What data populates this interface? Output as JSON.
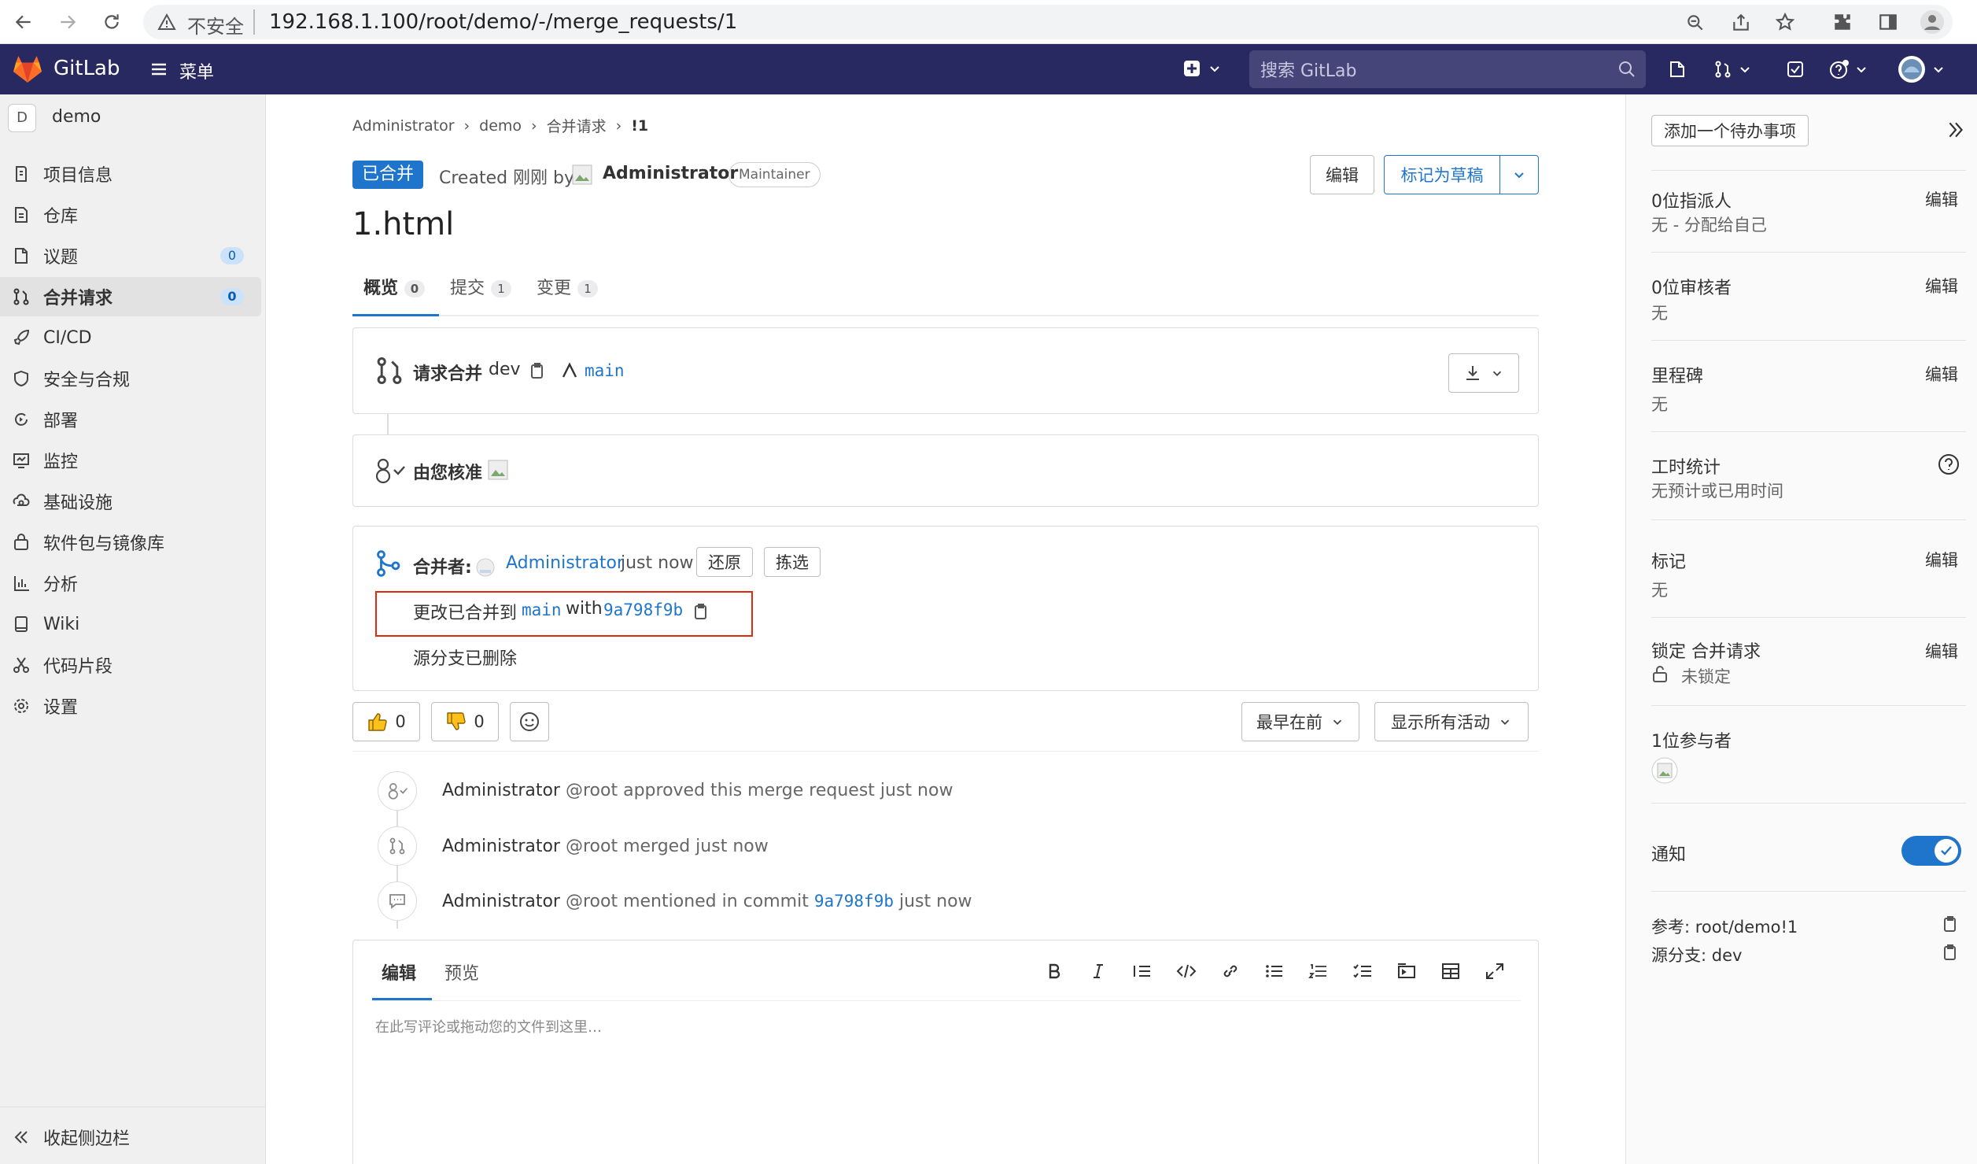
{
  "browser": {
    "security": "不安全",
    "url": "192.168.1.100/root/demo/-/merge_requests/1"
  },
  "header": {
    "brand": "GitLab",
    "menu_label": "菜单",
    "search_placeholder": "搜索 GitLab"
  },
  "sidebar": {
    "project_initial": "D",
    "project_name": "demo",
    "items": [
      {
        "label": "项目信息",
        "icon": "info-icon"
      },
      {
        "label": "仓库",
        "icon": "document-icon"
      },
      {
        "label": "议题",
        "icon": "issues-icon",
        "badge": "0"
      },
      {
        "label": "合并请求",
        "icon": "merge-request-icon",
        "badge": "0"
      },
      {
        "label": "CI/CD",
        "icon": "rocket-icon"
      },
      {
        "label": "安全与合规",
        "icon": "shield-icon"
      },
      {
        "label": "部署",
        "icon": "deploy-icon"
      },
      {
        "label": "监控",
        "icon": "monitor-icon"
      },
      {
        "label": "基础设施",
        "icon": "cloud-gear-icon"
      },
      {
        "label": "软件包与镜像库",
        "icon": "package-icon"
      },
      {
        "label": "分析",
        "icon": "chart-icon"
      },
      {
        "label": "Wiki",
        "icon": "book-icon"
      },
      {
        "label": "代码片段",
        "icon": "scissors-icon"
      },
      {
        "label": "设置",
        "icon": "gear-icon"
      }
    ],
    "collapse_label": "收起侧边栏"
  },
  "breadcrumb": [
    "Administrator",
    "demo",
    "合并请求",
    "!1"
  ],
  "mr": {
    "status": "已合并",
    "created_prefix": "Created 刚刚 by",
    "author": "Administrator",
    "role": "Maintainer",
    "edit_label": "编辑",
    "draft_label": "标记为草稿",
    "title": "1.html",
    "tabs": [
      {
        "label": "概览",
        "count": "0"
      },
      {
        "label": "提交",
        "count": "1"
      },
      {
        "label": "变更",
        "count": "1"
      }
    ],
    "request_label": "请求合并",
    "source_branch": "dev",
    "target_branch": "main",
    "approved_label": "由您核准",
    "merged_by_label": "合并者:",
    "merged_by_user": "Administrator",
    "merged_time": "just now",
    "revert_label": "还原",
    "cherry_pick_label": "拣选",
    "merged_into_prefix": "更改已合并到",
    "merged_with": "with",
    "commit": "9a798f9b",
    "branch_deleted": "源分支已删除",
    "thumbs_up": "0",
    "thumbs_down": "0",
    "sort_label": "最早在前",
    "filter_label": "显示所有活动"
  },
  "timeline": [
    {
      "user": "Administrator",
      "handle": "@root",
      "text": "approved this merge request just now",
      "icon": "approval-icon"
    },
    {
      "user": "Administrator",
      "handle": "@root",
      "text": "merged just now",
      "icon": "merge-icon"
    },
    {
      "user": "Administrator",
      "handle": "@root",
      "text_before": "mentioned in commit",
      "commit": "9a798f9b",
      "text_after": "just now",
      "icon": "comment-icon"
    }
  ],
  "editor": {
    "tab_write": "编辑",
    "tab_preview": "预览",
    "placeholder": "在此写评论或拖动您的文件到这里…"
  },
  "right_sidebar": {
    "add_todo": "添加一个待办事项",
    "assignee_title": "0位指派人",
    "assignee_value": "无 - 分配给自己",
    "reviewer_title": "0位审核者",
    "reviewer_value": "无",
    "milestone_title": "里程碑",
    "milestone_value": "无",
    "time_title": "工时统计",
    "time_value": "无预计或已用时间",
    "labels_title": "标记",
    "labels_value": "无",
    "lock_title": "锁定 合并请求",
    "lock_value": "未锁定",
    "participants_title": "1位参与者",
    "notify_title": "通知",
    "notify_on": true,
    "edit_label": "编辑",
    "reference": "参考: root/demo!1",
    "source_branch": "源分支: dev"
  },
  "colors": {
    "header_bg": "#292961",
    "accent": "#1f75cb",
    "merged": "#1f75cb",
    "highlight_border": "#dd2b0e"
  }
}
